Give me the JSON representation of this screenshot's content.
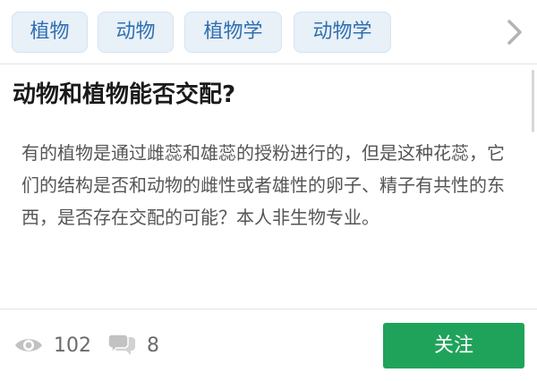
{
  "tags": [
    "植物",
    "动物",
    "植物学",
    "动物学"
  ],
  "question": {
    "title": "动物和植物能否交配?",
    "description": "有的植物是通过雌蕊和雄蕊的授粉进行的，但是这种花蕊，它们的结构是否和动物的雌性或者雄性的卵子、精子有共性的东西，是否存在交配的可能？本人非生物专业。"
  },
  "stats": {
    "views": "102",
    "comments": "8"
  },
  "follow_button": "关注",
  "icons": {
    "tag_scroll": "chevron-right-icon",
    "views": "eye-icon",
    "comments": "comment-bubbles-icon"
  },
  "colors": {
    "tag_bg": "#e8f0f8",
    "tag_text": "#2f6fb0",
    "follow_bg": "#1fa35a"
  }
}
